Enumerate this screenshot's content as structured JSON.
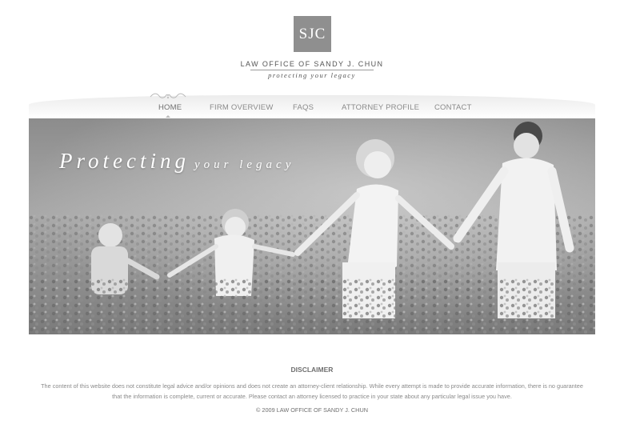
{
  "header": {
    "logo_text": "SJC",
    "firm_name": "LAW OFFICE OF SANDY J. CHUN",
    "tagline": "protecting your legacy"
  },
  "nav": {
    "items": [
      {
        "label": "HOME",
        "active": true
      },
      {
        "label": "FIRM OVERVIEW",
        "active": false
      },
      {
        "label": "FAQS",
        "active": false
      },
      {
        "label": "ATTORNEY PROFILE",
        "active": false
      },
      {
        "label": "CONTACT",
        "active": false
      }
    ]
  },
  "hero": {
    "title_big": "Protecting",
    "title_small": "your legacy",
    "image_subject": "family-walking-in-flower-field-photo"
  },
  "footer": {
    "disclaimer_title": "DISCLAIMER",
    "disclaimer_text": "The content of this website does not constitute legal advice and/or opinions and does not create an attorney-client relationship. While every attempt is made to provide accurate information, there is no guarantee that the information is complete, current or accurate. Please contact an attorney licensed to practice in your state about any particular legal issue you have.",
    "copyright": "© 2009 LAW OFFICE OF SANDY J. CHUN"
  },
  "colors": {
    "logo_bg": "#8f8f8f",
    "nav_text": "#8a8a8a",
    "body_text": "#8a8a8a"
  }
}
